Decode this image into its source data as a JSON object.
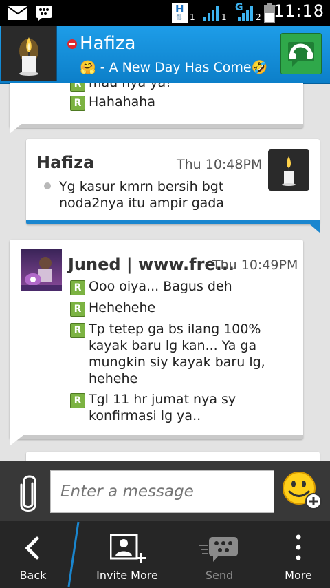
{
  "status_bar": {
    "time": "11:18",
    "h_label": "H",
    "sim1_index": "1",
    "g_label": "G",
    "sim2_index": "2",
    "icons": [
      "mail-icon",
      "bbm-icon",
      "h-data-icon",
      "signal-sim1-icon",
      "g-data-icon",
      "signal-sim2-icon",
      "battery-icon"
    ]
  },
  "header": {
    "name": "Hafiza",
    "status_message": "🤗 - A New Day Has Come🤣",
    "presence": "busy",
    "call_icon": "phone-icon"
  },
  "messages": [
    {
      "direction": "incoming",
      "lines": [
        {
          "icon": "read",
          "text": "mau nya ya!"
        },
        {
          "icon": "read",
          "text": "Hahahaha"
        }
      ]
    },
    {
      "direction": "outgoing",
      "sender": "Hafiza",
      "time": "Thu 10:48PM",
      "lines": [
        {
          "icon": "sent",
          "text": "Yg kasur kmrn bersih bgt noda2nya itu ampir gada"
        }
      ]
    },
    {
      "direction": "incoming",
      "sender": "Juned | www.fre...",
      "time": "Thu 10:49PM",
      "lines": [
        {
          "icon": "read",
          "text": "Ooo oiya... Bagus deh"
        },
        {
          "icon": "read",
          "text": "Hehehehe"
        },
        {
          "icon": "read",
          "text": "Tp tetep ga bs ilang 100% kayak baru lg kan... Ya ga mungkin siy kayak baru lg, hehehe"
        },
        {
          "icon": "read",
          "text": "Tgl 11 hr jumat nya sy konfirmasi lg ya.."
        }
      ]
    }
  ],
  "read_marker": "R",
  "composer": {
    "placeholder": "Enter a message",
    "attach_icon": "paperclip-icon",
    "emoticon_icon": "smiley-add-icon"
  },
  "toolbar": {
    "back": "Back",
    "invite_more": "Invite More",
    "send": "Send",
    "more": "More"
  },
  "colors": {
    "header_blue": "#1e9de8",
    "outgoing_accent": "#1a86cf",
    "read_green": "#7cb342",
    "call_green": "#2fa84a",
    "busy_red": "#e0282e"
  }
}
